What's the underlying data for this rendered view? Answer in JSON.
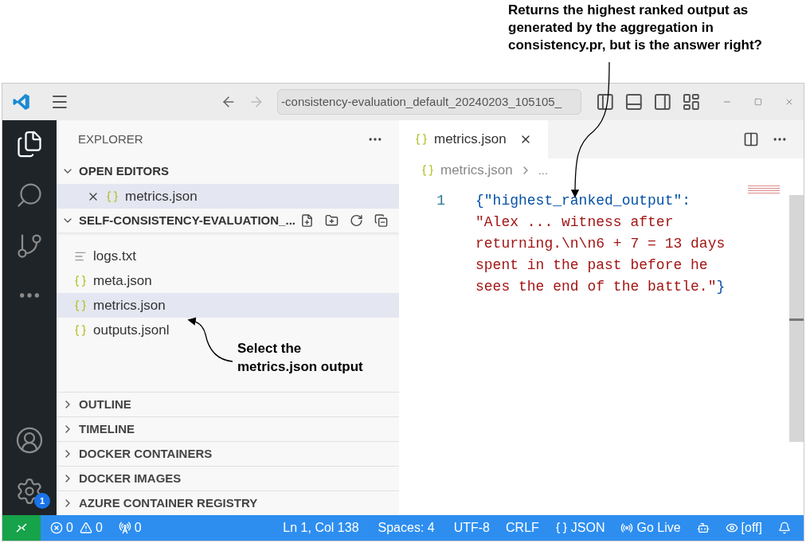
{
  "annotations": [
    {
      "text": "Returns the highest ranked output as generated by the aggregation in consistency.pr, but is the answer right?"
    },
    {
      "text": "Select the metrics.json output"
    }
  ],
  "title_bar": {
    "command_center": "-consistency-evaluation_default_20240203_105105_"
  },
  "activity_bar": {
    "settings_badge": "1"
  },
  "sidebar": {
    "title": "EXPLORER",
    "open_editors": {
      "label": "OPEN EDITORS",
      "expanded": true,
      "items": [
        {
          "name": "metrics.json",
          "selected": true
        }
      ]
    },
    "folder": {
      "label": "SELF-CONSISTENCY-EVALUATION_...",
      "expanded": true,
      "files": [
        {
          "name": "logs.txt",
          "kind": "text",
          "selected": false
        },
        {
          "name": "meta.json",
          "kind": "json",
          "selected": false
        },
        {
          "name": "metrics.json",
          "kind": "json",
          "selected": true
        },
        {
          "name": "outputs.jsonl",
          "kind": "json",
          "selected": false
        }
      ]
    },
    "sections": [
      {
        "label": "OUTLINE",
        "expanded": false
      },
      {
        "label": "TIMELINE",
        "expanded": false
      },
      {
        "label": "DOCKER CONTAINERS",
        "expanded": false
      },
      {
        "label": "DOCKER IMAGES",
        "expanded": false
      },
      {
        "label": "AZURE CONTAINER REGISTRY",
        "expanded": false
      }
    ]
  },
  "editor": {
    "tabs": [
      {
        "label": "metrics.json",
        "selected": true
      }
    ],
    "breadcrumb": [
      "metrics.json",
      "..."
    ],
    "lines": [
      {
        "number": "1",
        "tokens": [
          {
            "kind": "key",
            "text": "{\"highest_ranked_output\":"
          },
          {
            "kind": "string",
            "text": " \"Alex ... witness after returning.\\n\\n6 + 7 = 13 days spent in the past before he sees the end of the battle.\""
          },
          {
            "kind": "punct",
            "text": "}"
          }
        ]
      }
    ]
  },
  "status_bar": {
    "errors": "0",
    "warnings": "0",
    "ports": "0",
    "position": "Ln 1, Col 138",
    "indent": "Spaces: 4",
    "encoding": "UTF-8",
    "eol": "CRLF",
    "language": "JSON",
    "live": "Go Live",
    "prettier": "[off]"
  }
}
